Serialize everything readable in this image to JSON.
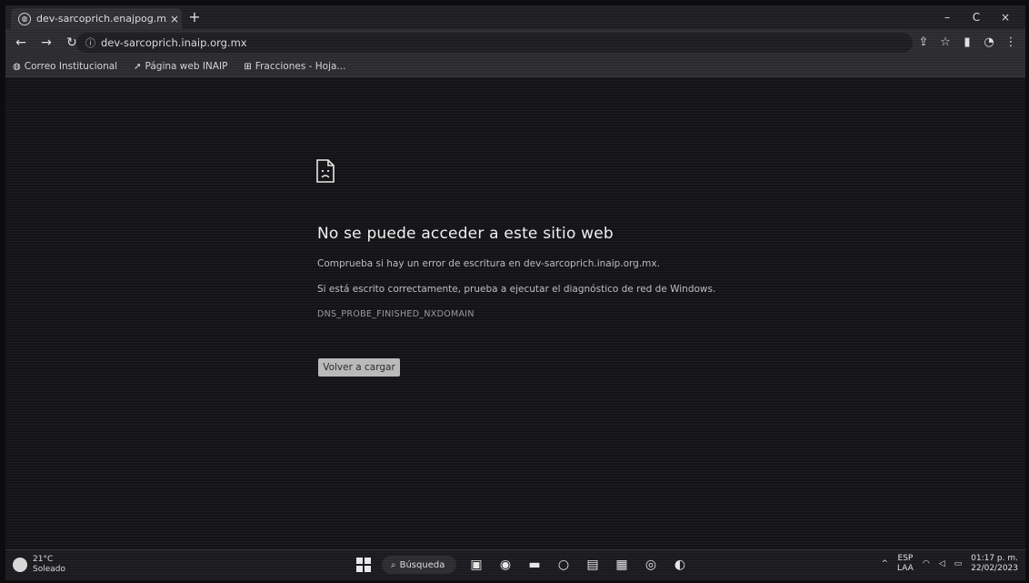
{
  "browser": {
    "tab_title": "dev-sarcoprich.enajpog.mx",
    "tab_close": "×",
    "new_tab": "+",
    "window_controls": [
      "–",
      "C",
      "×"
    ],
    "url": "dev-sarcoprich.inaip.org.mx",
    "url_info_icon": "ⓘ"
  },
  "bookmarks": [
    {
      "icon": "globe-icon",
      "label": "Correo Institucional"
    },
    {
      "icon": "arrow-icon",
      "label": "Página web INAIP"
    },
    {
      "icon": "grid-icon",
      "label": "Fracciones - Hoja..."
    }
  ],
  "error": {
    "title": "No se puede acceder a este sitio web",
    "line1": "Comprueba si hay un error de escritura en dev-sarcoprich.inaip.org.mx.",
    "line2": "Si está escrito correctamente, prueba a ejecutar el diagnóstico de red de Windows.",
    "code": "DNS_PROBE_FINISHED_NXDOMAIN",
    "reload_label": "Volver a cargar"
  },
  "taskbar": {
    "weather_temp": "21°C",
    "weather_desc": "Soleado",
    "search_label": "Búsqueda",
    "lang_top": "ESP",
    "lang_bottom": "LAA",
    "time": "01:17 p. m.",
    "date": "22/02/2023"
  },
  "colors": {
    "background": "#141417",
    "chrome": "#2b2b30",
    "button": "#b9b9b9"
  }
}
